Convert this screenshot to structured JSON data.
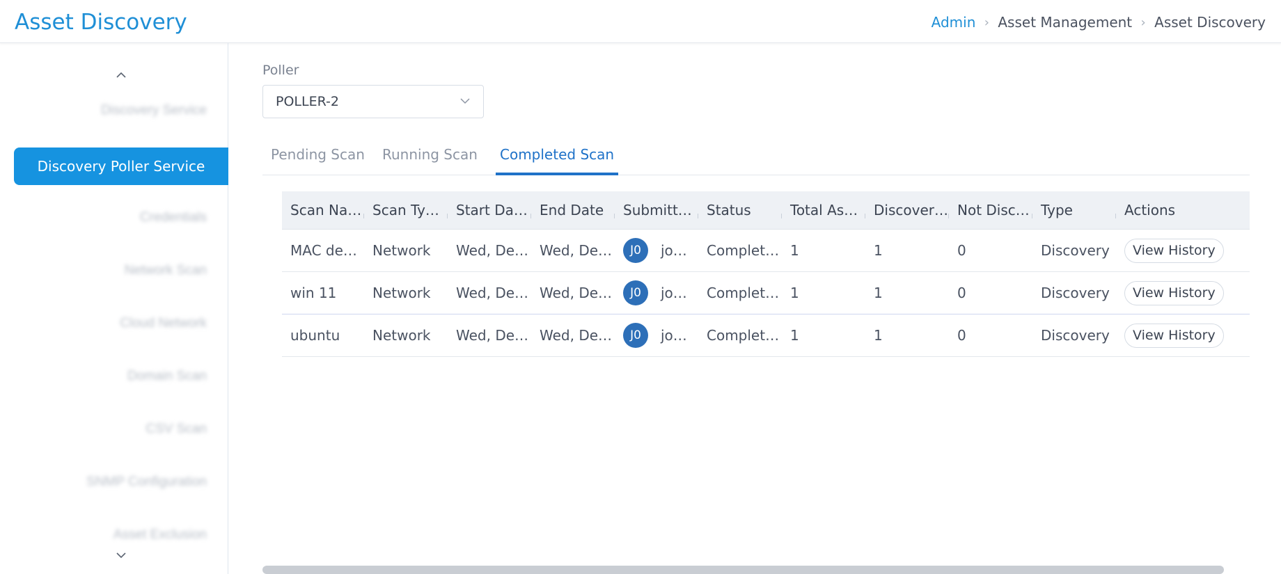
{
  "header": {
    "title": "Asset Discovery",
    "breadcrumb": [
      "Admin",
      "Asset Management",
      "Asset Discovery"
    ]
  },
  "sidebar": {
    "active_item": "Discovery Poller Service",
    "items": [
      "Discovery Service",
      "Credentials",
      "Network Scan",
      "Cloud Network",
      "Domain Scan",
      "CSV Scan",
      "SNMP Configuration",
      "Asset Exclusion"
    ]
  },
  "poller": {
    "label": "Poller",
    "value": "POLLER-2"
  },
  "tabs": [
    {
      "label": "Pending Scan",
      "active": false
    },
    {
      "label": "Running Scan",
      "active": false
    },
    {
      "label": "Completed Scan",
      "active": true
    }
  ],
  "table": {
    "columns": [
      "Scan Na…",
      "Scan Ty…",
      "Start Da…",
      "End Date",
      "Submitt…",
      "Status",
      "Total As…",
      "Discover…",
      "Not Disc…",
      "Type",
      "Actions"
    ],
    "rows": [
      {
        "scan_name": "MAC de…",
        "scan_type": "Network",
        "start_date": "Wed, De…",
        "end_date": "Wed, De…",
        "avatar": "J0",
        "submitter": "jo…",
        "status": "Complet…",
        "total": "1",
        "discovered": "1",
        "not_discovered": "0",
        "type": "Discovery",
        "action": "View History"
      },
      {
        "scan_name": "win 11",
        "scan_type": "Network",
        "start_date": "Wed, De…",
        "end_date": "Wed, De…",
        "avatar": "J0",
        "submitter": "jo…",
        "status": "Complet…",
        "total": "1",
        "discovered": "1",
        "not_discovered": "0",
        "type": "Discovery",
        "action": "View History"
      },
      {
        "scan_name": "ubuntu",
        "scan_type": "Network",
        "start_date": "Wed, De…",
        "end_date": "Wed, De…",
        "avatar": "J0",
        "submitter": "jo…",
        "status": "Complet…",
        "total": "1",
        "discovered": "1",
        "not_discovered": "0",
        "type": "Discovery",
        "action": "View History"
      }
    ]
  },
  "colors": {
    "accent": "#1f8fd6",
    "active_tab": "#1f72c8",
    "sidebar_active_bg": "#1693e0",
    "avatar_bg": "#2d6fb8"
  }
}
